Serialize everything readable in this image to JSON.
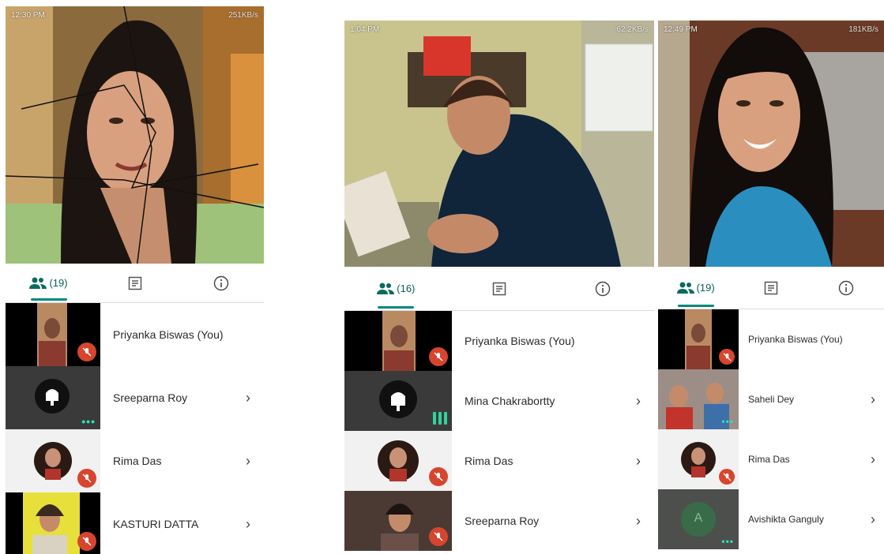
{
  "screens": [
    {
      "status_time": "12:30 PM",
      "status_right": "251KB/s",
      "participants_count": "(19)",
      "participants": [
        {
          "name": "Priyanka Biswas (You)",
          "muted": true
        },
        {
          "name": "Sreeparna Roy",
          "muted": false
        },
        {
          "name": "Rima Das",
          "muted": true
        },
        {
          "name": "KASTURI DATTA",
          "muted": true
        }
      ]
    },
    {
      "status_time": "1:04 PM",
      "status_right": "62.2KB/s",
      "participants_count": "(16)",
      "participants": [
        {
          "name": "Priyanka Biswas (You)",
          "muted": true
        },
        {
          "name": "Mina Chakrabortty",
          "muted": false
        },
        {
          "name": "Rima Das",
          "muted": true
        },
        {
          "name": "Sreeparna Roy",
          "muted": true
        }
      ]
    },
    {
      "status_time": "12:49 PM",
      "status_right": "181KB/s",
      "participants_count": "(19)",
      "participants": [
        {
          "name": "Priyanka Biswas (You)",
          "muted": true
        },
        {
          "name": "Saheli Dey",
          "muted": false
        },
        {
          "name": "Rima Das",
          "muted": true
        },
        {
          "name": "Avishikta Ganguly",
          "muted": false
        }
      ],
      "avatar_letter": "A"
    }
  ],
  "colors": {
    "accent": "#00897b",
    "mic_muted": "#d7452f",
    "speaking": "#2fd39b"
  },
  "icons": [
    "people-icon",
    "chat-icon",
    "info-icon",
    "chevron-right-icon",
    "mic-off-icon",
    "bell-icon"
  ]
}
